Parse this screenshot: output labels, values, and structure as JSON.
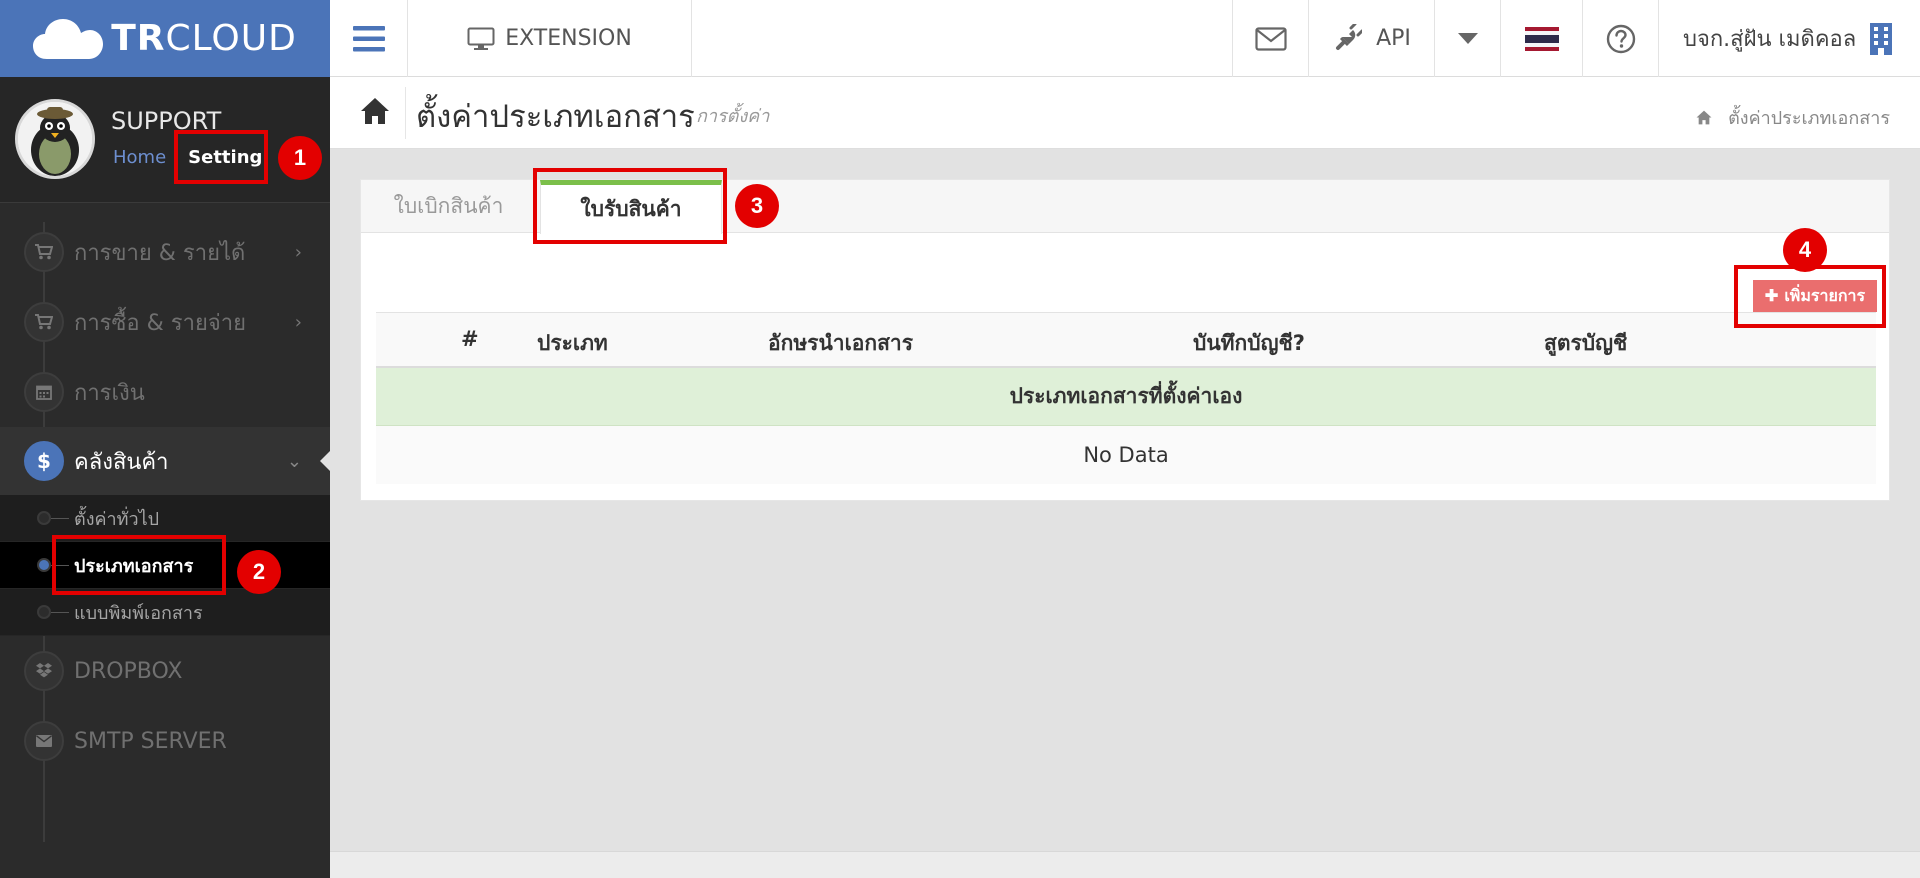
{
  "brand": {
    "logo_bold": "TR",
    "logo_rest": "CLOUD"
  },
  "topbar": {
    "extension_label": "EXTENSION",
    "api_label": "API",
    "company_name": "บจก.สู่ฝัน เมดิคอล"
  },
  "profile": {
    "name": "SUPPORT",
    "home_link": "Home",
    "setting_link": "Setting"
  },
  "sidebar": {
    "items": [
      {
        "label": "การขาย & รายได้",
        "icon": "cart-icon",
        "expandable": true
      },
      {
        "label": "การซื้อ & รายจ่าย",
        "icon": "cart-icon",
        "expandable": true
      },
      {
        "label": "การเงิน",
        "icon": "calendar-icon",
        "expandable": false
      },
      {
        "label": "คลังสินค้า",
        "icon": "dollar-icon",
        "expandable": true,
        "active": true
      }
    ],
    "active_icon_glyph": "$",
    "subitems": [
      {
        "label": "ตั้งค่าทั่วไป"
      },
      {
        "label": "ประเภทเอกสาร",
        "selected": true
      },
      {
        "label": "แบบพิมพ์เอกสาร"
      }
    ],
    "bottom_items": [
      {
        "label": "DROPBOX",
        "icon": "dropbox-icon"
      },
      {
        "label": "SMTP SERVER",
        "icon": "envelope-icon"
      }
    ]
  },
  "page": {
    "title": "ตั้งค่าประเภทเอกสาร",
    "subtitle": "การตั้งค่า",
    "breadcrumb": "ตั้งค่าประเภทเอกสาร"
  },
  "tabs": [
    {
      "label": "ใบเบิกสินค้า",
      "active": false
    },
    {
      "label": "ใบรับสินค้า",
      "active": true
    }
  ],
  "add_button": {
    "label": "เพิ่มรายการ"
  },
  "table": {
    "columns": [
      "#",
      "ประเภท",
      "อักษรนำเอกสาร",
      "บันทึกบัญชี?",
      "สูตรบัญชี"
    ],
    "group_label": "ประเภทเอกสารที่ตั้งค่าเอง",
    "empty_text": "No Data"
  },
  "annotations": [
    "1",
    "2",
    "3",
    "4"
  ],
  "colors": {
    "brand_blue": "#4b74b8",
    "sidebar_bg": "#2b2b2b",
    "tab_accent": "#7bbf4a",
    "add_button": "#ea6e6e",
    "group_row": "#dff0d8",
    "annotation_red": "#e30000"
  }
}
